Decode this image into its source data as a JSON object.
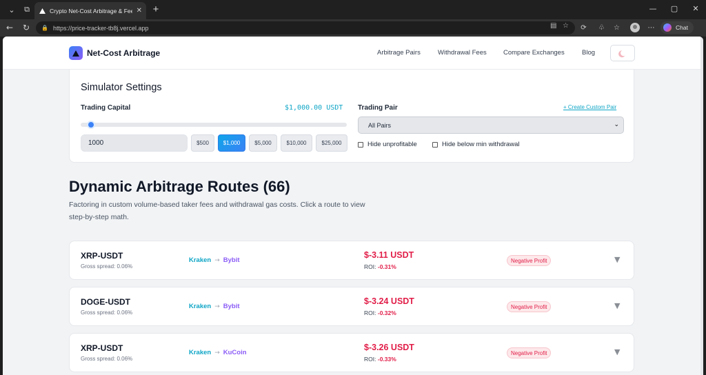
{
  "browser": {
    "tab_title": "Crypto Net-Cost Arbitrage & Fee C",
    "url": "https://price-tracker-tb8j.vercel.app",
    "chat_label": "Chat"
  },
  "site": {
    "brand": "Net-Cost Arbitrage",
    "nav": [
      "Arbitrage Pairs",
      "Withdrawal Fees",
      "Compare Exchanges",
      "Blog"
    ]
  },
  "simulator": {
    "title": "Simulator Settings",
    "capital_label": "Trading Capital",
    "capital_display": "$1,000.00 USDT",
    "slider_fraction": 0.025,
    "capital_input": "1000",
    "presets": [
      "$500",
      "$1,000",
      "$5,000",
      "$10,000",
      "$25,000"
    ],
    "active_preset": "$1,000",
    "pair_label": "Trading Pair",
    "create_link": "+ Create Custom Pair",
    "pair_select": "All Pairs",
    "hide_unprofitable": "Hide unprofitable",
    "hide_below_min": "Hide below min withdrawal"
  },
  "routes": {
    "title": "Dynamic Arbitrage Routes (66)",
    "subtitle": "Factoring in custom volume-based taker fees and withdrawal gas costs. Click a route to view step-by-step math.",
    "items": [
      {
        "pair": "XRP-USDT",
        "gross_spread": "Gross spread: 0.06%",
        "from": "Kraken",
        "to": "Bybit",
        "profit": "$-3.11 USDT",
        "roi_label": "ROI:",
        "roi": "-0.31%",
        "badge": "Negative Profit"
      },
      {
        "pair": "DOGE-USDT",
        "gross_spread": "Gross spread: 0.06%",
        "from": "Kraken",
        "to": "Bybit",
        "profit": "$-3.24 USDT",
        "roi_label": "ROI:",
        "roi": "-0.32%",
        "badge": "Negative Profit"
      },
      {
        "pair": "XRP-USDT",
        "gross_spread": "Gross spread: 0.06%",
        "from": "Kraken",
        "to": "KuCoin",
        "profit": "$-3.26 USDT",
        "roi_label": "ROI:",
        "roi": "-0.33%",
        "badge": "Negative Profit"
      }
    ]
  },
  "colors": {
    "accent_cyan": "#0ea5c6",
    "accent_purple": "#8b5cf6",
    "negative": "#e11d48",
    "primary_blue": "#3b82f6"
  }
}
